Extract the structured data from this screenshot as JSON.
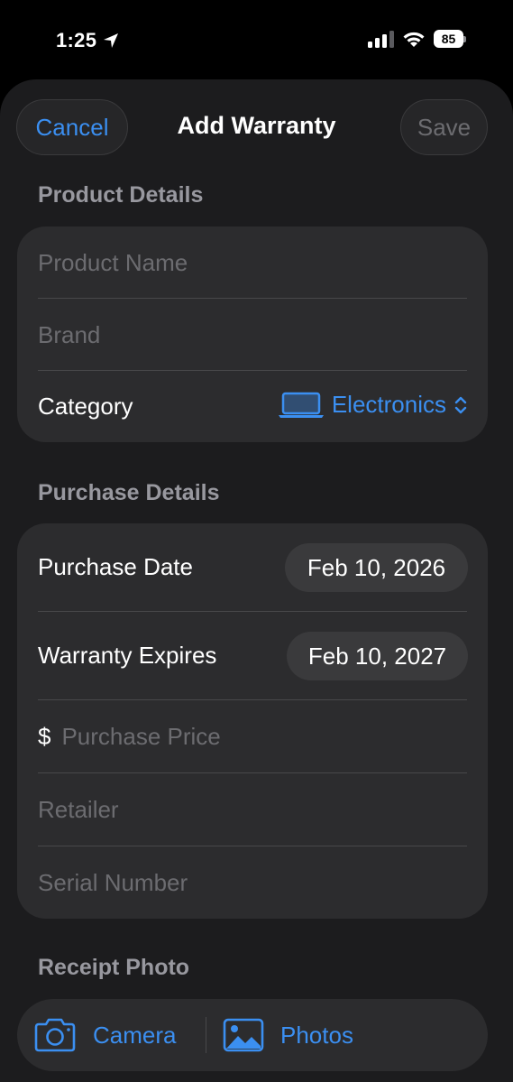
{
  "status_bar": {
    "time": "1:25",
    "battery": "85"
  },
  "nav": {
    "cancel_label": "Cancel",
    "title": "Add Warranty",
    "save_label": "Save"
  },
  "product_details": {
    "header": "Product Details",
    "product_name_placeholder": "Product Name",
    "brand_placeholder": "Brand",
    "category_label": "Category",
    "category_value": "Electronics",
    "category_icon": "laptop-icon"
  },
  "purchase_details": {
    "header": "Purchase Details",
    "purchase_date_label": "Purchase Date",
    "purchase_date_value": "Feb 10, 2026",
    "warranty_expires_label": "Warranty Expires",
    "warranty_expires_value": "Feb 10, 2027",
    "currency_symbol": "$",
    "purchase_price_placeholder": "Purchase Price",
    "retailer_placeholder": "Retailer",
    "serial_number_placeholder": "Serial Number"
  },
  "receipt_photo": {
    "header": "Receipt Photo",
    "camera_label": "Camera",
    "photos_label": "Photos"
  },
  "colors": {
    "accent": "#3b8ff1",
    "background": "#1c1c1e",
    "card": "#2c2c2e",
    "placeholder": "#6c6c70",
    "section_header": "#98989f"
  }
}
